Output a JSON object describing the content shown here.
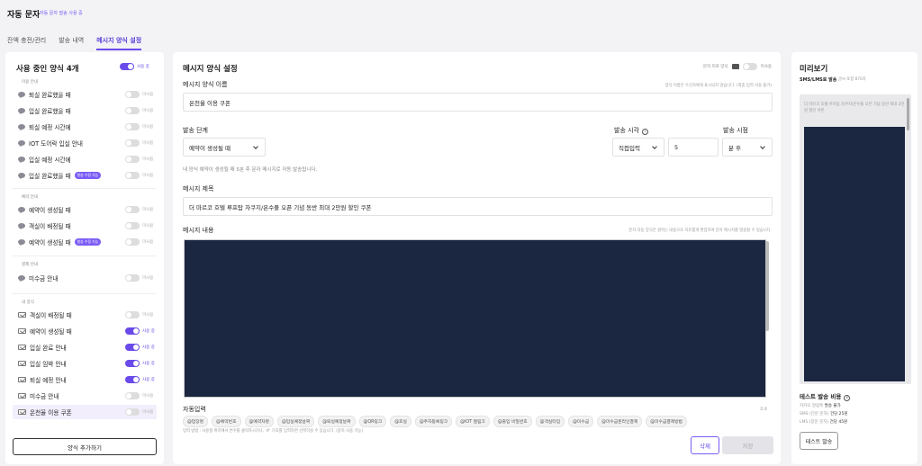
{
  "header": {
    "title": "자동 문자",
    "subtitle": "자동 문자 발송 사용 중"
  },
  "tabs": [
    {
      "label": "잔액 충전/관리",
      "active": false
    },
    {
      "label": "발송 내역",
      "active": false
    },
    {
      "label": "메시지 양식 설정",
      "active": true
    }
  ],
  "left": {
    "title": "사용 중인 양식",
    "count": "4개",
    "master_toggle_label": "사용 중",
    "sections": [
      {
        "label": "이용 안내",
        "items": [
          {
            "icon": "chat-bubble-icon",
            "label": "퇴실 완료했을 때",
            "badge": "",
            "on": false,
            "status": "미사용"
          },
          {
            "icon": "chat-bubble-icon",
            "label": "입실 완료했을 때",
            "badge": "",
            "on": false,
            "status": "미사용"
          },
          {
            "icon": "chat-bubble-icon",
            "label": "퇴실 예정 시간에",
            "badge": "",
            "on": false,
            "status": "미사용"
          },
          {
            "icon": "chat-bubble-icon",
            "label": "IOT 도어락 입실 안내",
            "badge": "",
            "on": false,
            "status": "미사용"
          },
          {
            "icon": "chat-bubble-icon",
            "label": "입실 예정 시간에",
            "badge": "",
            "on": false,
            "status": "미사용"
          },
          {
            "icon": "chat-bubble-icon",
            "label": "입실 완료했을 때",
            "badge": "발송 수정 가능",
            "on": false,
            "status": "미사용"
          }
        ]
      },
      {
        "label": "예약 안내",
        "items": [
          {
            "icon": "chat-bubble-icon",
            "label": "예약이 생성될 때",
            "badge": "",
            "on": false,
            "status": "미사용"
          },
          {
            "icon": "chat-bubble-icon",
            "label": "객실이 배정될 때",
            "badge": "",
            "on": false,
            "status": "미사용"
          },
          {
            "icon": "chat-bubble-icon",
            "label": "예약이 생성될 때",
            "badge": "발송 수정 가능",
            "on": false,
            "status": "미사용"
          }
        ]
      },
      {
        "label": "결제 안내",
        "items": [
          {
            "icon": "chat-bubble-icon",
            "label": "미수금 안내",
            "badge": "",
            "on": false,
            "status": "미사용"
          }
        ]
      },
      {
        "label": "내 양식",
        "items": [
          {
            "icon": "mail-icon",
            "label": "객실이 배정될 때",
            "badge": "",
            "on": false,
            "status": "미사용"
          },
          {
            "icon": "mail-icon",
            "label": "예약이 생성될 때",
            "badge": "",
            "on": true,
            "status": "사용 중"
          },
          {
            "icon": "mail-icon",
            "label": "입실 완료 안내",
            "badge": "",
            "on": true,
            "status": "사용 중"
          },
          {
            "icon": "mail-icon",
            "label": "입실 임박 안내",
            "badge": "",
            "on": true,
            "status": "사용 중"
          },
          {
            "icon": "mail-icon",
            "label": "퇴실 예정 안내",
            "badge": "",
            "on": true,
            "status": "사용 중"
          },
          {
            "icon": "mail-icon",
            "label": "미수금 안내",
            "badge": "",
            "on": false,
            "status": "미사용"
          },
          {
            "icon": "mail-icon",
            "label": "온천율 이용 쿠폰",
            "badge": "",
            "on": false,
            "status": "미사용",
            "selected": true
          }
        ]
      }
    ],
    "add_button": "양식 추가하기"
  },
  "editor": {
    "title": "메시지 양식 설정",
    "top_right_label": "문자 미로 양식",
    "top_right_status": "미사용",
    "name_label": "메시지 양식 이름",
    "name_hint": "양식 이름은 수신자에게 표시되지 않습니다. (최종 입력 사용 불가)",
    "name_value": "온천율 이용 쿠폰",
    "stage_label": "발송 단계",
    "stage_value": "예약이 생성될 때",
    "time_label": "발송 시각",
    "time_mode": "직접입력",
    "time_value": "5",
    "point_label": "발송 시점",
    "point_value": "분 후",
    "stage_hint": "내 양식 예약이 생성될 때 5분 후 문자 메시지로 자동 발송됩니다.",
    "subject_label": "메시지 제목",
    "subject_value": "더 마르코 호텔 루프탑 자쿠지/온수풀 오픈 기념 동반 최대 2만원 할인 쿠폰",
    "content_label": "메시지 내용",
    "content_hint": "문자 자동 양식은 원하는 내용으로 자유롭게 편집하여 문자 메시지를 발송할 수 있습니다.",
    "auto_label": "자동입력",
    "auto_hint_right": "초과",
    "chips": [
      "@업장명",
      "@예약번호",
      "@예약자명",
      "@입실예정날짜",
      "@퇴실예정날짜",
      "@QR링크",
      "@호실",
      "@주차등록링크",
      "@IOT 열림크",
      "@출입 비밀번호",
      "@객실타입",
      "@미수금",
      "@미수금온라인결제",
      "@미수금결제방법"
    ],
    "chips_hint": "입력 방법 : 사용할 위치에서 변수를 클릭하시거나, '#' 기호를 입력하면 선택하실 수 있습니다. (중복 사용 가능)",
    "delete_label": "삭제",
    "save_label": "저장"
  },
  "preview": {
    "title": "미리보기",
    "type_label": "SMS/LMS로 발송",
    "type_sub": "글씨 포함 870자",
    "preview_text": "더 마르코 호텔 루프탑 자쿠지/온수풀 오픈 기념 동반 최대 2만원 할인 쿠폰",
    "cost_title": "테스트 발송 비용",
    "cost_lines": [
      {
        "label": "카카오 알림톡",
        "value": "발송 불가"
      },
      {
        "label": "SMS (단문 문자)",
        "value": "건당 25원"
      },
      {
        "label": "LMS (장문 문자)",
        "value": "건당 45원"
      }
    ],
    "test_button": "테스트 발송"
  },
  "colors": {
    "accent": "#6a4bea",
    "dark_editor": "#1b2640"
  }
}
